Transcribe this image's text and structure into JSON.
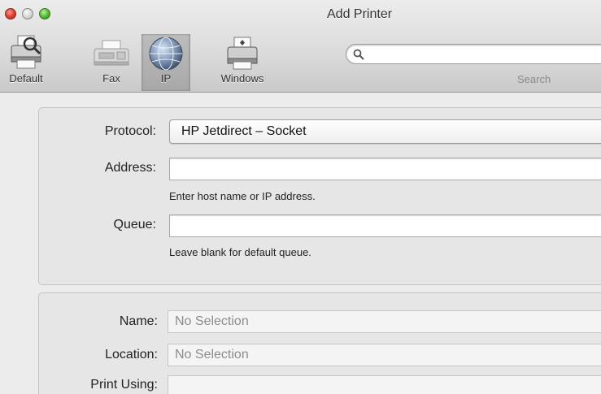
{
  "window": {
    "title": "Add Printer"
  },
  "toolbar": {
    "items": [
      {
        "label": "Default",
        "icon": "default-printer-icon"
      },
      {
        "label": "Fax",
        "icon": "fax-icon"
      },
      {
        "label": "IP",
        "icon": "ip-globe-icon",
        "selected": true
      },
      {
        "label": "Windows",
        "icon": "windows-printer-icon"
      }
    ],
    "search": {
      "label": "Search",
      "value": ""
    }
  },
  "connection": {
    "protocol_label": "Protocol:",
    "protocol_value": "HP Jetdirect – Socket",
    "address_label": "Address:",
    "address_value": "",
    "address_hint": "Enter host name or IP address.",
    "queue_label": "Queue:",
    "queue_value": "",
    "queue_hint": "Leave blank for default queue."
  },
  "details": {
    "name_label": "Name:",
    "name_value": "No Selection",
    "location_label": "Location:",
    "location_value": "No Selection",
    "print_using_label": "Print Using:",
    "print_using_value": ""
  },
  "colors": {
    "close": "#e2463a",
    "minimize": "#d6d6d6",
    "zoom": "#5cc23b",
    "disabled_text": "#8c8c8c"
  }
}
